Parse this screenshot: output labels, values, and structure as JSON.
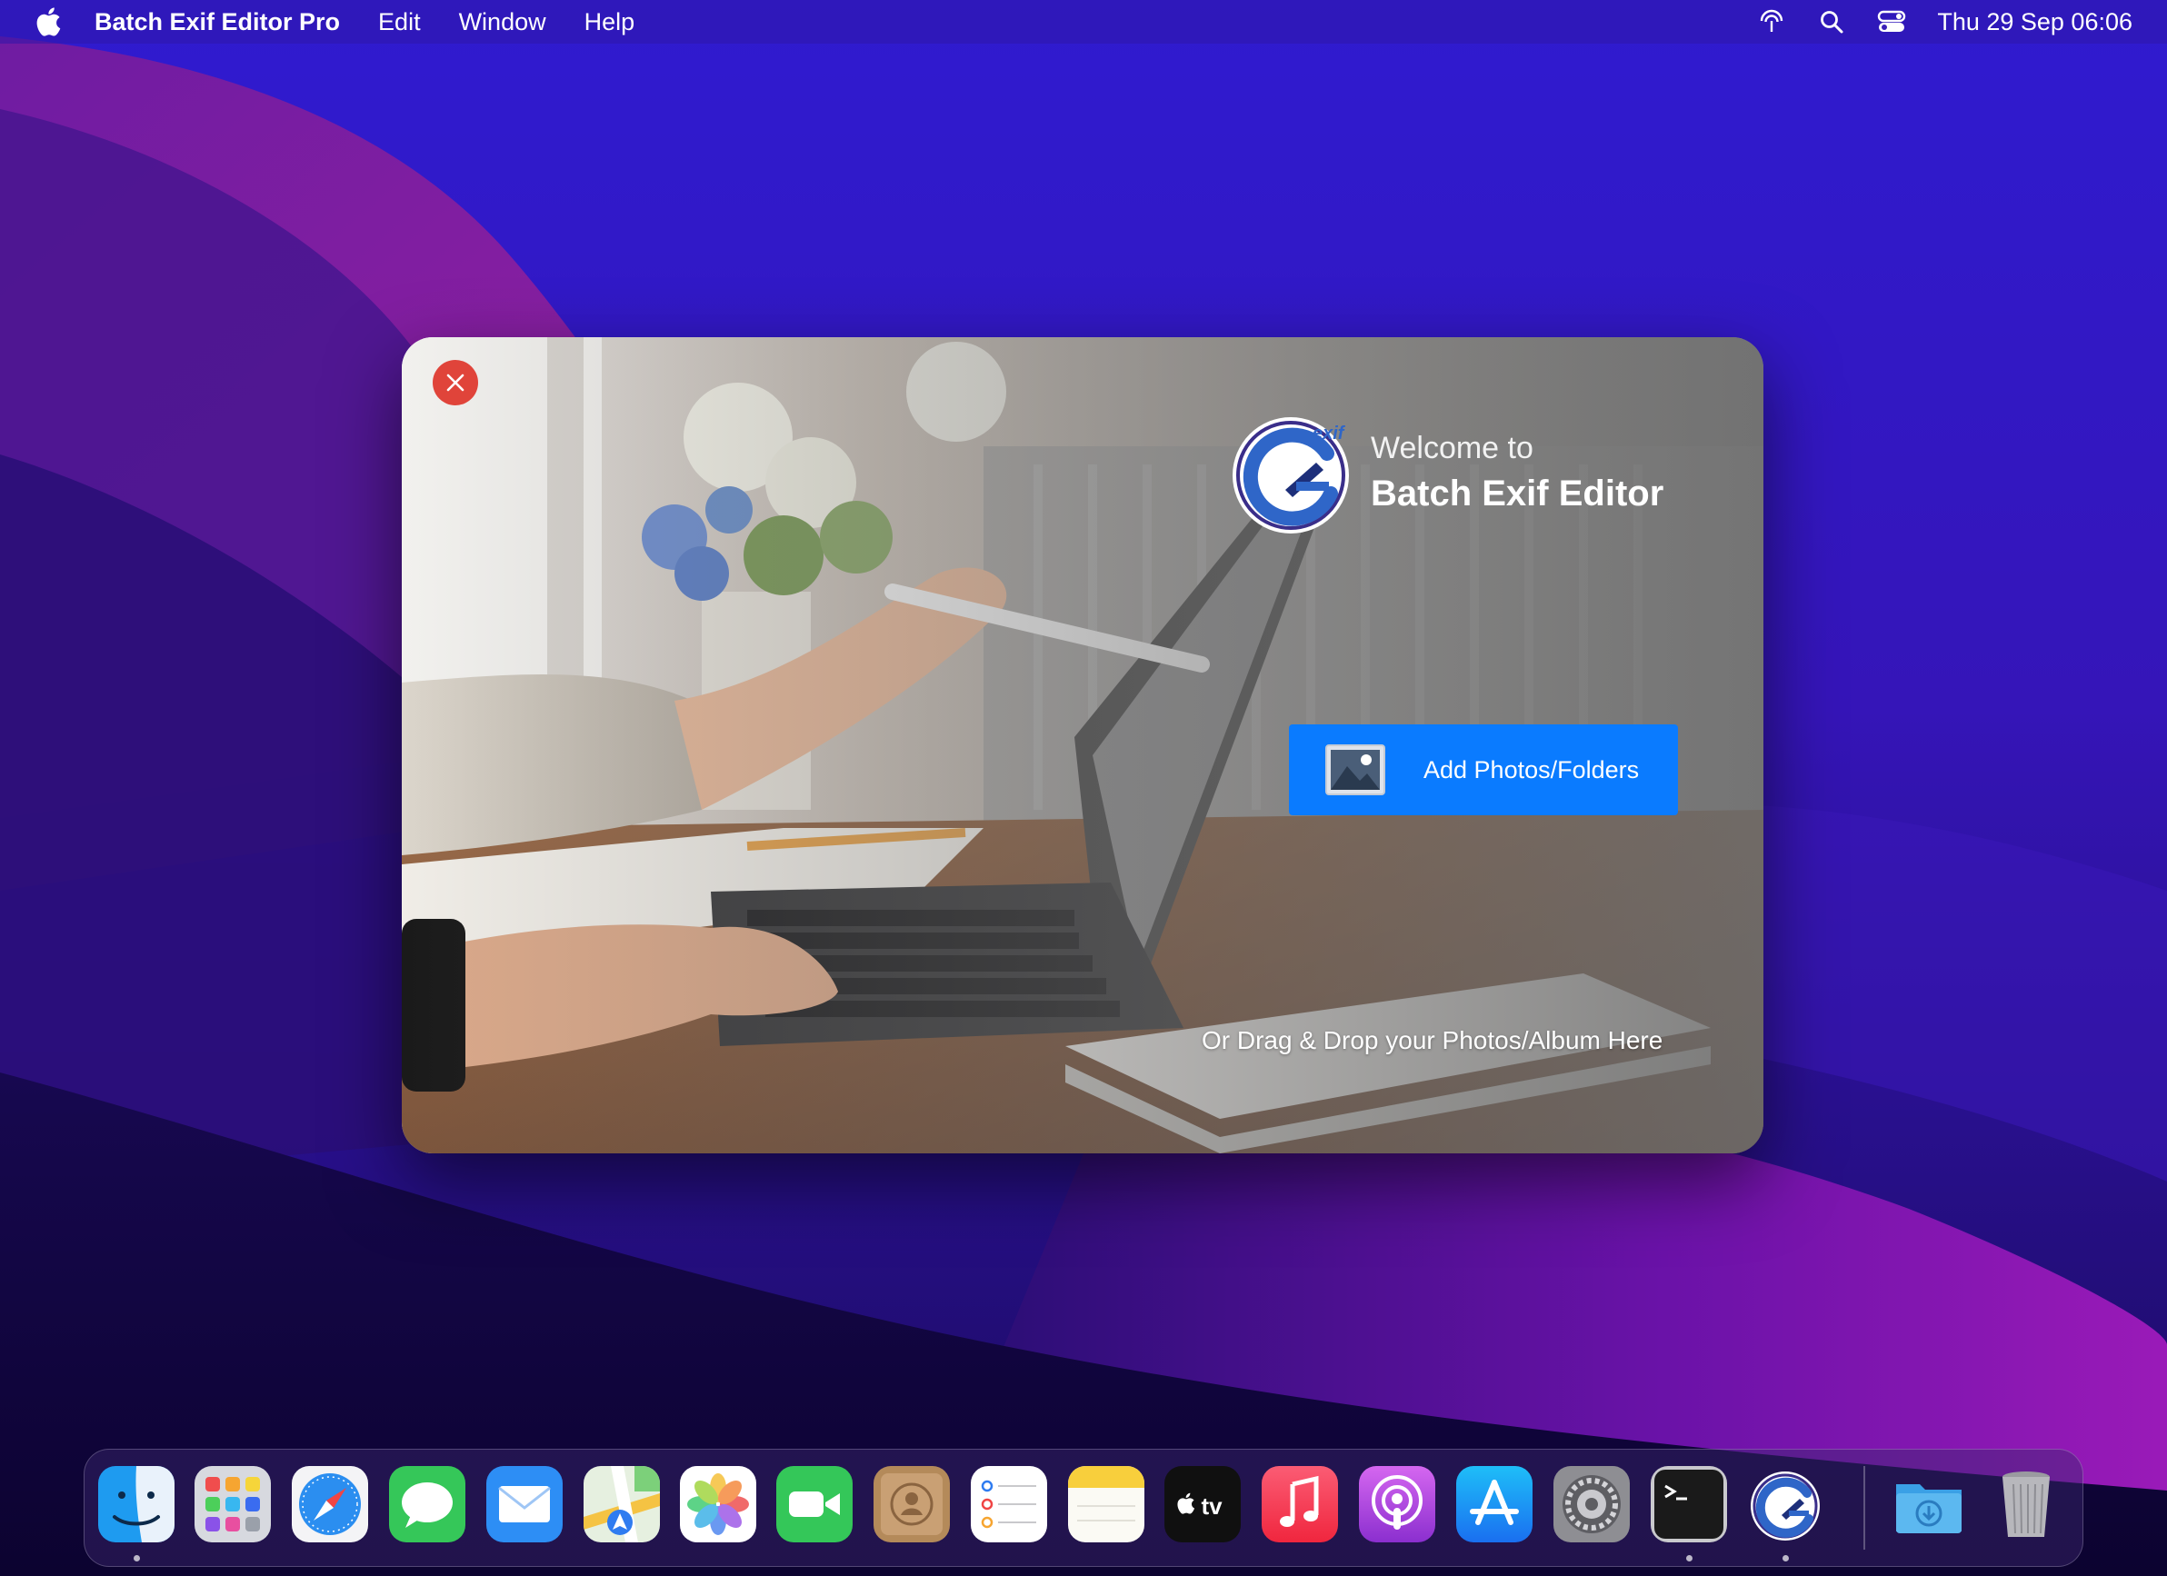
{
  "menubar": {
    "app_name": "Batch Exif Editor Pro",
    "menus": [
      "Edit",
      "Window",
      "Help"
    ],
    "clock": "Thu 29 Sep  06:06",
    "icons": [
      "apple-logo",
      "airdrop-icon",
      "spotlight-search-icon",
      "control-center-icon"
    ]
  },
  "welcome": {
    "heading_small": "Welcome to",
    "heading_large": "Batch Exif Editor",
    "logo_text": "exif",
    "add_button_label": "Add Photos/Folders",
    "drop_hint": "Or Drag & Drop your Photos/Album Here",
    "close_icon": "close-icon"
  },
  "dock": {
    "items": [
      {
        "name": "Finder",
        "icon": "finder-icon",
        "running": true
      },
      {
        "name": "Launchpad",
        "icon": "launchpad-icon",
        "running": false
      },
      {
        "name": "Safari",
        "icon": "safari-icon",
        "running": false
      },
      {
        "name": "Messages",
        "icon": "messages-icon",
        "running": false
      },
      {
        "name": "Mail",
        "icon": "mail-icon",
        "running": false
      },
      {
        "name": "Maps",
        "icon": "maps-icon",
        "running": false
      },
      {
        "name": "Photos",
        "icon": "photos-icon",
        "running": false
      },
      {
        "name": "FaceTime",
        "icon": "facetime-icon",
        "running": false
      },
      {
        "name": "Contacts",
        "icon": "contacts-icon",
        "running": false
      },
      {
        "name": "Reminders",
        "icon": "reminders-icon",
        "running": false
      },
      {
        "name": "Notes",
        "icon": "notes-icon",
        "running": false
      },
      {
        "name": "TV",
        "icon": "apple-tv-icon",
        "running": false
      },
      {
        "name": "Music",
        "icon": "music-icon",
        "running": false
      },
      {
        "name": "Podcasts",
        "icon": "podcasts-icon",
        "running": false
      },
      {
        "name": "App Store",
        "icon": "app-store-icon",
        "running": false
      },
      {
        "name": "System Preferences",
        "icon": "system-preferences-icon",
        "running": false
      },
      {
        "name": "Terminal",
        "icon": "terminal-icon",
        "running": true
      },
      {
        "name": "Batch Exif Editor Pro",
        "icon": "batch-exif-editor-icon",
        "running": true
      },
      {
        "name": "Downloads",
        "icon": "downloads-folder-icon",
        "running": false
      },
      {
        "name": "Trash",
        "icon": "trash-icon",
        "running": false
      }
    ],
    "tv_label": "tv"
  },
  "colors": {
    "accent_button": "#0a7bff",
    "close_button": "#e0443a",
    "wallpaper_base": "#23107a",
    "wallpaper_magenta": "#b0249a"
  }
}
